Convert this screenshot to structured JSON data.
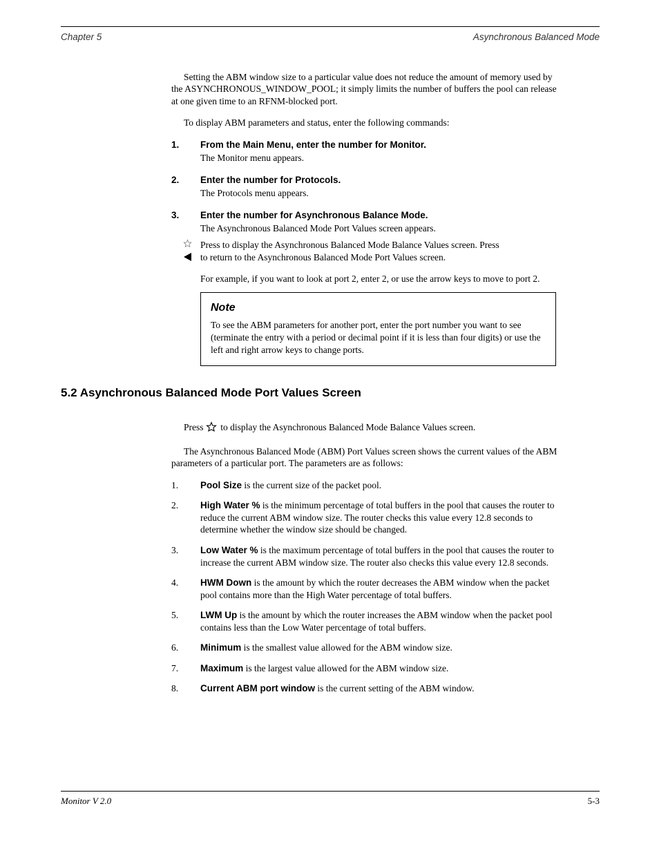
{
  "header": {
    "left": "Chapter 5",
    "right": "Asynchronous Balanced Mode"
  },
  "intro_para": "Setting the ABM window size to a particular value does not reduce the amount of memory used by the ASYNCHRONOUS_WINDOW_POOL; it simply limits the number of buffers the pool can release at one given time to an RFNM-blocked port.",
  "procedure_intro": "To display ABM parameters and status, enter the following commands:",
  "steps": [
    {
      "num": "1.",
      "text_sans": "From the Main Menu, enter the number for Monitor.",
      "sub": "The Monitor menu appears."
    },
    {
      "num": "2.",
      "text_sans": "Enter the number for Protocols.",
      "sub": "The Protocols menu appears."
    },
    {
      "num": "3.",
      "text_sans": "Enter the number for Asynchronous Balance Mode.",
      "sub": "The Asynchronous Balanced Mode Port Values screen appears."
    }
  ],
  "step3_tail": {
    "line1_prefix": "Press ",
    "line1_after_star": " to display the Asynchronous Balanced Mode Balance Values screen. Press",
    "line2": " to return to the Asynchronous Balanced Mode Port Values screen."
  },
  "example_line": "For example, if you want to look at port 2, enter 2, or use the arrow keys to move to port 2.",
  "note": {
    "title": "Note",
    "body": "To see the ABM parameters for another port, enter the port number you want to see (terminate the entry with a period or decimal point if it is less than four digits) or use the left and right arrow keys to change ports."
  },
  "section_heading": "5.2  Asynchronous Balanced Mode Port Values Screen",
  "section_para_1_pre": "Press ",
  "section_para_1_post": " to display the Asynchronous Balanced Mode Balance Values screen.",
  "section_para_2": "The Asynchronous Balanced Mode (ABM) Port Values screen shows the current values of the ABM parameters of a particular port. The parameters are as follows:",
  "params": [
    {
      "num": "1.",
      "label": "Pool Size",
      "desc": " is the current size of the packet pool."
    },
    {
      "num": "2.",
      "label": "High Water %",
      "desc": " is the minimum percentage of total buffers in the pool that causes the router to reduce the current ABM window size. The router checks this value every 12.8 seconds to determine whether the window size should be changed."
    },
    {
      "num": "3.",
      "label": "Low Water %",
      "desc": " is the maximum percentage of total buffers in the pool that causes the router to increase the current ABM window size. The router also checks this value every 12.8 seconds."
    },
    {
      "num": "4.",
      "label": "HWM Down",
      "desc": " is the amount by which the router decreases the ABM window when the packet pool contains more than the High Water percentage of total buffers."
    },
    {
      "num": "5.",
      "label": "LWM Up",
      "desc": " is the amount by which the router increases the ABM window when the packet pool contains less than the Low Water percentage of total buffers."
    },
    {
      "num": "6.",
      "label": "Minimum",
      "desc": " is the smallest value allowed for the ABM window size."
    },
    {
      "num": "7.",
      "label": "Maximum",
      "desc": " is the largest value allowed for the ABM window size."
    },
    {
      "num": "8.",
      "label": "Current ABM port window",
      "desc": " is the current setting of the ABM window."
    }
  ],
  "footer": {
    "left": "Monitor    V 2.0",
    "right": "5-3"
  }
}
